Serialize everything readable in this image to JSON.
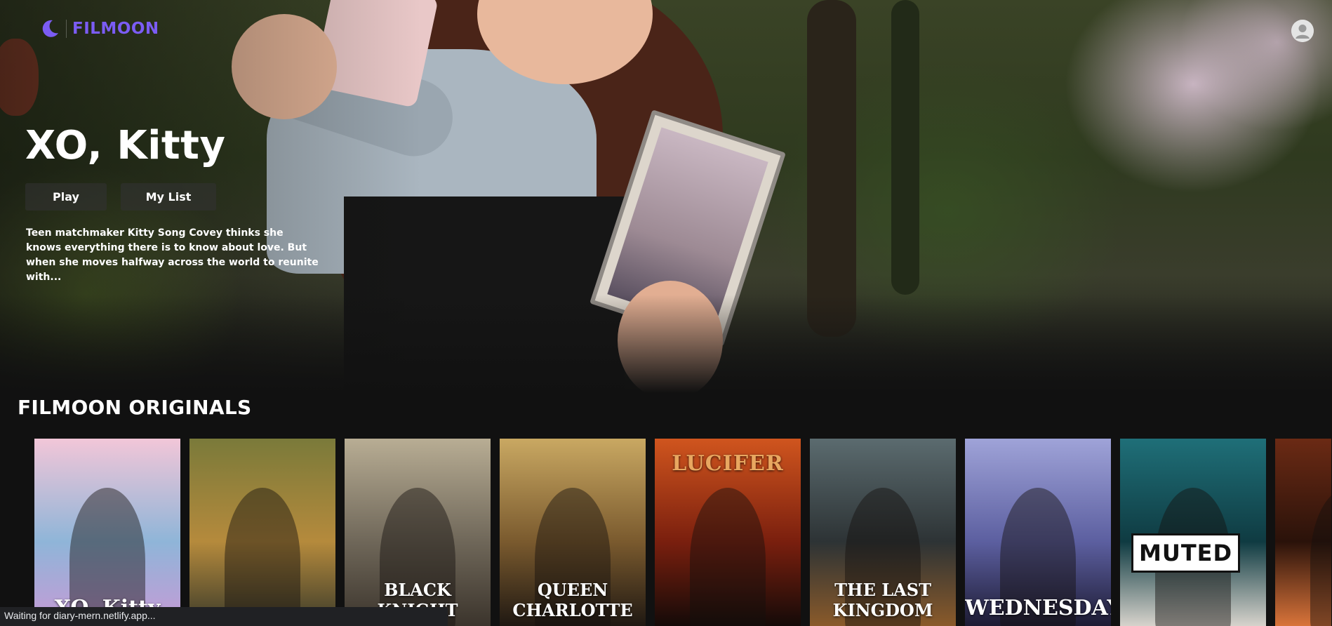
{
  "app": {
    "brand": "FILMOON",
    "brand_color": "#7b5cf4",
    "icons": {
      "logo": "moon-icon",
      "profile": "user-avatar-icon"
    }
  },
  "hero": {
    "title": "XO, Kitty",
    "play_label": "Play",
    "mylist_label": "My List",
    "description": "Teen matchmaker Kitty Song Covey thinks she knows everything there is to know about love. But when she moves halfway across the world to reunite with..."
  },
  "row": {
    "title": "FILMOON ORIGINALS",
    "posters": [
      {
        "label": "XO, Kitty",
        "colors": [
          "#f2c6d8",
          "#8fb5d8",
          "#c79ad6"
        ]
      },
      {
        "label": "",
        "colors": [
          "#7a7a3a",
          "#b58a3c",
          "#3a3a2a"
        ]
      },
      {
        "label": "BLACK KNIGHT",
        "colors": [
          "#b8ad94",
          "#6f6759",
          "#3b342c"
        ]
      },
      {
        "label": "QUEEN CHARLOTTE",
        "colors": [
          "#c9a862",
          "#7a5a2e",
          "#1f1812"
        ]
      },
      {
        "label": "LUCIFER",
        "colors": [
          "#d0551e",
          "#7a1f0e",
          "#140a08"
        ]
      },
      {
        "label": "THE LAST KINGDOM",
        "colors": [
          "#5b6b6f",
          "#2d3335",
          "#8a5a2a"
        ]
      },
      {
        "label": "WEDNESDAY",
        "colors": [
          "#9fa3d8",
          "#5c5fa0",
          "#1d1b33"
        ]
      },
      {
        "label": "MUTED",
        "colors": [
          "#1f6f78",
          "#0f3b42",
          "#d7d3cc"
        ]
      },
      {
        "label": "",
        "colors": [
          "#6b2a14",
          "#2a120a",
          "#d9743a"
        ]
      }
    ]
  },
  "status": {
    "text": "Waiting for diary-mern.netlify.app..."
  }
}
